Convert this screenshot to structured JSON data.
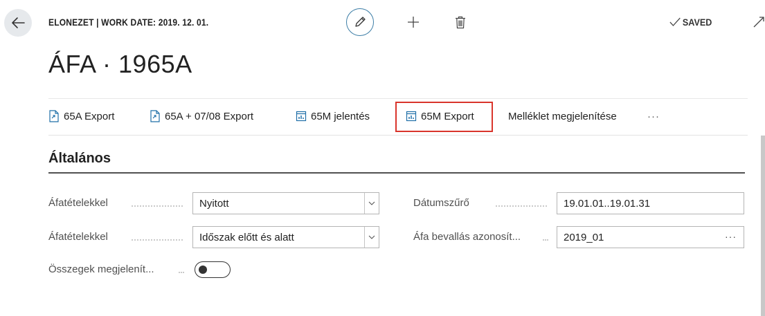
{
  "header": {
    "caption": "ELONEZET | WORK DATE: 2019. 12. 01.",
    "title": "ÁFA · 1965A",
    "saved_status": "SAVED"
  },
  "icons": {
    "back": "arrow-left-icon",
    "edit": "pencil-icon",
    "new": "plus-icon",
    "delete": "trash-icon",
    "saved": "checkmark-icon",
    "expand": "expand-icon"
  },
  "actions": [
    {
      "label": "65A Export",
      "icon": "document-export-icon"
    },
    {
      "label": "65A + 07/08 Export",
      "icon": "document-export-icon"
    },
    {
      "label": "65M jelentés",
      "icon": "report-icon"
    },
    {
      "label": "65M Export",
      "icon": "report-icon",
      "highlighted": true
    },
    {
      "label": "Melléklet megjelenítése",
      "icon": ""
    },
    {
      "label": "···",
      "icon": ""
    }
  ],
  "section": {
    "title": "Általános"
  },
  "fields": {
    "afatetelekkel_1": {
      "label": "Áfatételekkel",
      "value": "Nyitott"
    },
    "afatetelekkel_2": {
      "label": "Áfatételekkel",
      "value": "Időszak előtt és alatt"
    },
    "osszegek": {
      "label": "Összegek megjelenít...",
      "value_state": false
    },
    "datumszuro": {
      "label": "Dátumszűrő",
      "value": "19.01.01..19.01.31"
    },
    "afa_bevallas": {
      "label": "Áfa bevallás azonosít...",
      "value": "2019_01",
      "button": "···"
    }
  },
  "colors": {
    "accent": "#3a7ca5",
    "highlight_border": "#d9342b",
    "icon_blue": "#1f6fa8"
  }
}
